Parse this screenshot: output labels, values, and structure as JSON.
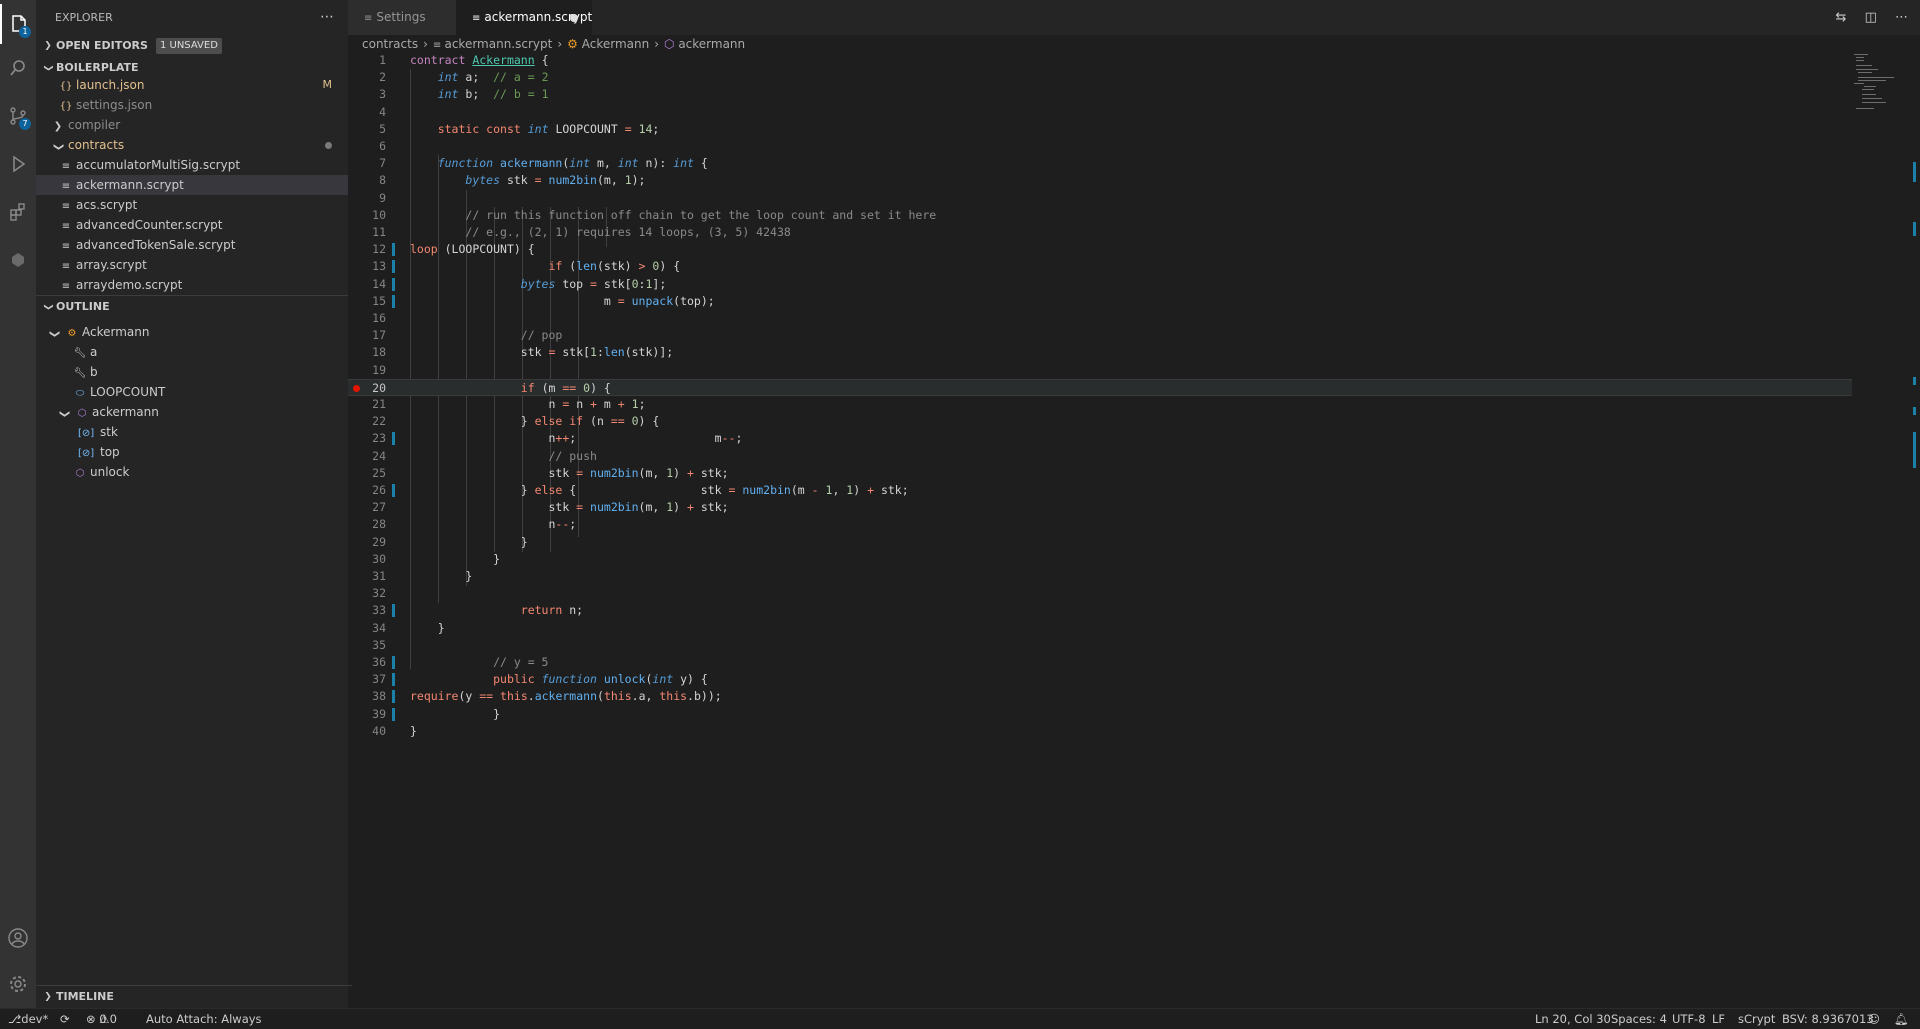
{
  "sidebar": {
    "title": "EXPLORER",
    "open_editors": {
      "label": "OPEN EDITORS",
      "badge": "1 UNSAVED"
    },
    "project": {
      "label": "BOILERPLATE"
    },
    "files": [
      {
        "name": "launch.json",
        "status": "M"
      },
      {
        "name": "settings.json"
      },
      {
        "name": "compiler"
      },
      {
        "name": "contracts"
      },
      {
        "name": "accumulatorMultiSig.scrypt"
      },
      {
        "name": "ackermann.scrypt"
      },
      {
        "name": "acs.scrypt"
      },
      {
        "name": "advancedCounter.scrypt"
      },
      {
        "name": "advancedTokenSale.scrypt"
      },
      {
        "name": "array.scrypt"
      },
      {
        "name": "arraydemo.scrypt"
      }
    ],
    "outline": {
      "label": "OUTLINE",
      "items": [
        "Ackermann",
        "a",
        "b",
        "LOOPCOUNT",
        "ackermann",
        "stk",
        "top",
        "unlock"
      ]
    },
    "timeline": {
      "label": "TIMELINE"
    }
  },
  "activity": {
    "explorer_badge": "1",
    "scm_badge": "7"
  },
  "tabs": [
    {
      "label": "Settings"
    },
    {
      "label": "ackermann.scrypt"
    }
  ],
  "breadcrumb": {
    "folder": "contracts",
    "file": "ackermann.scrypt",
    "class": "Ackermann",
    "method": "ackermann"
  },
  "editor": {
    "current_line": 20,
    "lines": [
      "1",
      "2",
      "3",
      "4",
      "5",
      "6",
      "7",
      "8",
      "9",
      "10",
      "11",
      "12",
      "13",
      "14",
      "15",
      "16",
      "17",
      "18",
      "19",
      "20",
      "21",
      "22",
      "23",
      "24",
      "25",
      "26",
      "27",
      "28",
      "29",
      "30",
      "31",
      "32",
      "33",
      "34",
      "35",
      "36",
      "37",
      "38",
      "39",
      "40"
    ],
    "comments": {
      "l2": "// a = 2",
      "l3": "// b = 1",
      "l10": "// run this function off chain to get the loop count and set it here",
      "l11": "// e.g., (2, 1) requires 14 loops, (3, 5) 42438",
      "l17": "// pop",
      "l24": "// push",
      "l36": "// y = 5"
    }
  },
  "statusbar": {
    "branch": "dev*",
    "errors": "0",
    "warnings": "0",
    "auto_attach": "Auto Attach: Always",
    "position": "Ln 20, Col 30",
    "spaces": "Spaces: 4",
    "encoding": "UTF-8",
    "eol": "LF",
    "language": "sCrypt",
    "bsv": "BSV: 8.9367013"
  },
  "colors": {
    "accent": "#1b81a8",
    "breakpoint": "#e51400",
    "background": "#1e1e1e",
    "sidebar": "#252526"
  }
}
